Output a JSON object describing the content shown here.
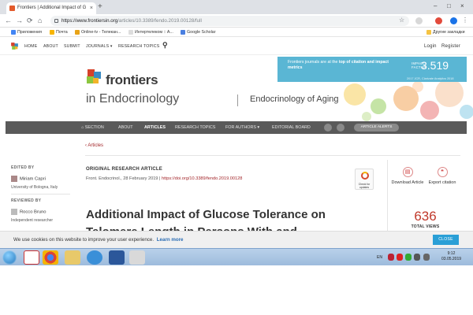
{
  "browser": {
    "tab_title": "Frontiers | Additional Impact of G",
    "tab_close": "×",
    "new_tab": "+",
    "url_host": "https://www.frontiersin.org",
    "url_path": "/articles/10.3389/fendo.2019.00128/full",
    "win_min": "–",
    "win_max": "□",
    "win_close": "×",
    "back": "←",
    "forward": "→",
    "reload": "⟳",
    "home": "⌂",
    "star": "☆"
  },
  "bookmarks": {
    "items": [
      "Приложения",
      "Почта",
      "Online-tv - Телекан...",
      "Интертелеком :: А...",
      "Google Scholar"
    ],
    "other": "Другие закладки"
  },
  "site_nav": {
    "items": [
      "HOME",
      "ABOUT",
      "SUBMIT",
      "JOURNALS ▾",
      "RESEARCH TOPICS"
    ],
    "login": "Login",
    "register": "Register"
  },
  "banner": {
    "impact_text_pre": "Frontiers journals are at the ",
    "impact_text_bold": "top of citation and impact metrics",
    "impact_label_1": "IMPACT",
    "impact_label_2": "FACTOR",
    "impact_value": "3.519",
    "impact_sub": "2017 JCR, Clarivate Analytics 2018",
    "brand": "frontiers",
    "journal": "in Endocrinology",
    "section": "Endocrinology of Aging"
  },
  "journal_nav": {
    "items": [
      "SECTION",
      "ABOUT",
      "ARTICLES",
      "RESEARCH TOPICS",
      "FOR AUTHORS ▾",
      "EDITORIAL BOARD"
    ],
    "alerts": "ARTICLE ALERTS"
  },
  "breadcrumb": "‹ Articles",
  "sidebar": {
    "edited_by": "EDITED BY",
    "editor_name": "Miriam Capri",
    "editor_aff": "University of Bologna, Italy",
    "reviewed_by": "REVIEWED BY",
    "reviewer_name": "Rocco Bruno",
    "reviewer_aff": "Independent researcher"
  },
  "article": {
    "type": "ORIGINAL RESEARCH ARTICLE",
    "meta_pre": "Front. Endocrinol., 28 February 2019 | ",
    "doi": "https://doi.org/10.3389/fendo.2019.00128",
    "check_label": "Check for updates",
    "title": "Additional Impact of Glucose Tolerance on Telomere Length in Persons With and"
  },
  "actions": {
    "download": "Download Article",
    "export": "Export citation",
    "views_value": "636",
    "views_label": "TOTAL VIEWS"
  },
  "cookie": {
    "text": "We use cookies on this website to improve your user experience.",
    "learn_more": "Learn more",
    "close": "CLOSE"
  },
  "taskbar": {
    "lang": "EN",
    "time": "9:12",
    "date": "03.05.2019"
  },
  "colors": {
    "accent_red": "#a3262a",
    "impact_blue": "#5ab6d4",
    "nav_dark": "#5a5a5a",
    "cookie_btn": "#2a9fd6"
  }
}
